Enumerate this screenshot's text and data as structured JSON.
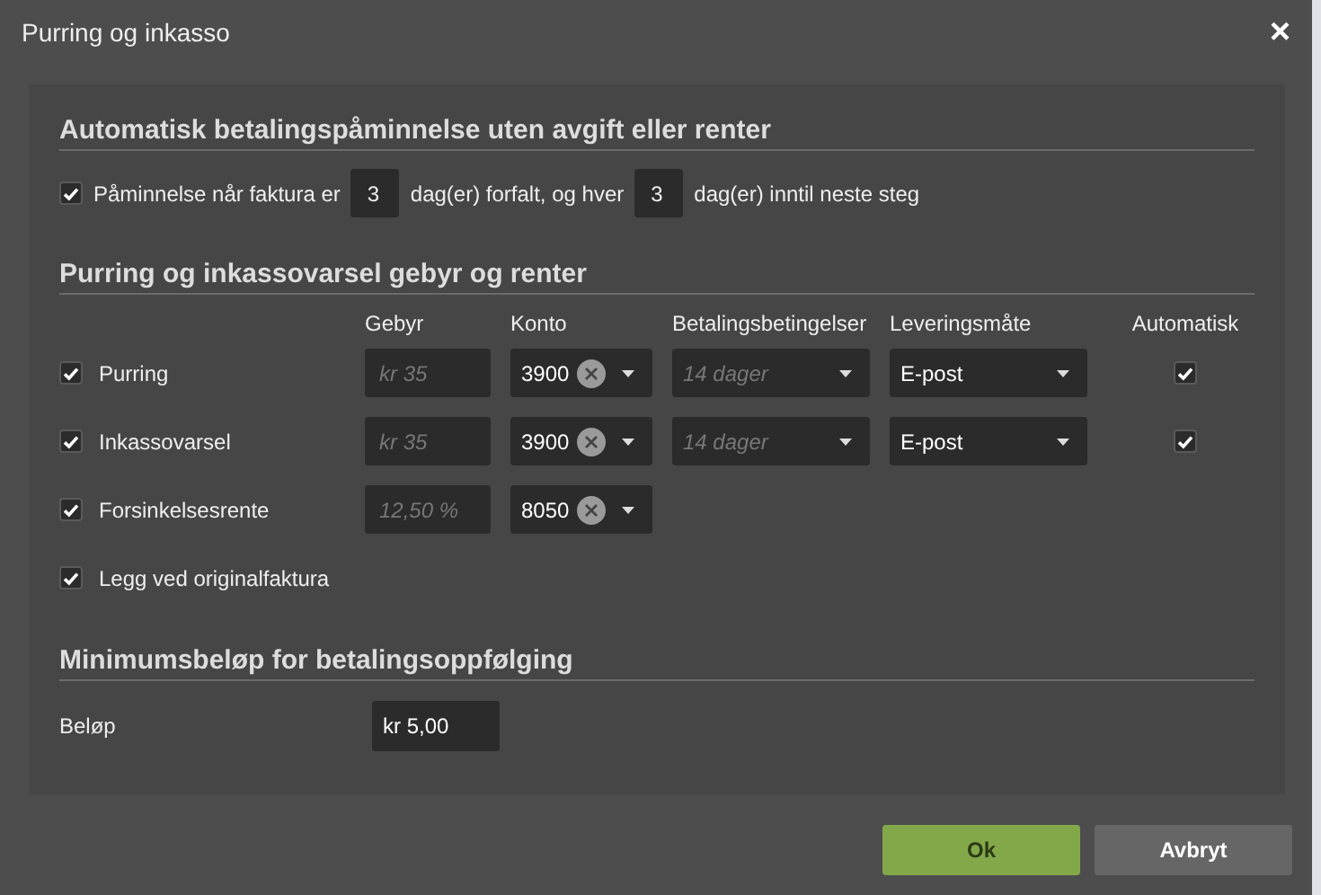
{
  "dialog": {
    "title": "Purring og inkasso",
    "close": "×"
  },
  "reminder_section": {
    "heading": "Automatisk betalingspåminnelse uten avgift eller renter",
    "checked": true,
    "text_1": "Påminnelse når faktura er",
    "days_overdue": "3",
    "text_2": "dag(er) forfalt, og hver",
    "days_interval": "3",
    "text_3": "dag(er) inntil neste steg"
  },
  "fees_section": {
    "heading": "Purring og inkassovarsel gebyr og renter",
    "columns": [
      "Gebyr",
      "Konto",
      "Betalingsbetingelser",
      "Leveringsmåte",
      "Automatisk"
    ],
    "rows": [
      {
        "kind": "full",
        "label": "Purring",
        "checked": true,
        "fee_placeholder": "kr 35",
        "account": "3900",
        "terms_placeholder": "14 dager",
        "delivery": "E-post",
        "automatic": true
      },
      {
        "kind": "full",
        "label": "Inkassovarsel",
        "checked": true,
        "fee_placeholder": "kr 35",
        "account": "3900",
        "terms_placeholder": "14 dager",
        "delivery": "E-post",
        "automatic": true
      },
      {
        "kind": "fee",
        "label": "Forsinkelsesrente",
        "checked": true,
        "fee_placeholder": "12,50 %",
        "account": "8050"
      },
      {
        "kind": "option",
        "label": "Legg ved originalfaktura",
        "checked": true
      }
    ]
  },
  "minimum_section": {
    "heading": "Minimumsbeløp for betalingsoppfølging",
    "label": "Beløp",
    "amount": "kr 5,00"
  },
  "buttons": [
    {
      "label": "Ok",
      "kind": "primary"
    },
    {
      "label": "Avbryt",
      "kind": "secondary"
    }
  ]
}
